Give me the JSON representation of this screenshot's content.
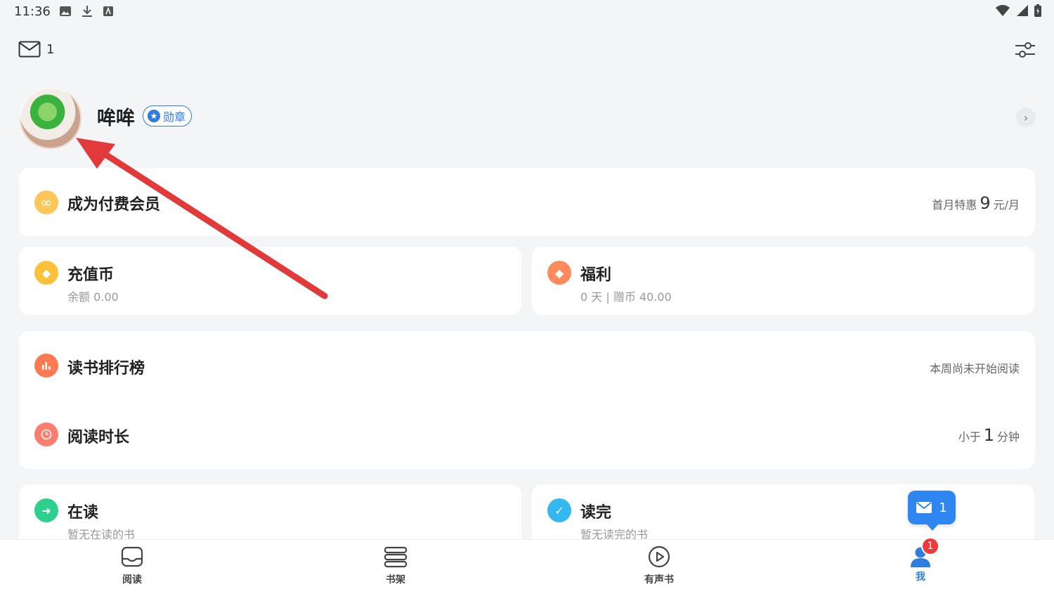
{
  "status_bar": {
    "time": "11:36"
  },
  "top": {
    "mail_count": "1"
  },
  "profile": {
    "name": "哞哞",
    "badge": "勋章"
  },
  "vip": {
    "title": "成为付费会员",
    "promo_prefix": "首月特惠",
    "promo_price": "9",
    "promo_suffix": "元/月"
  },
  "coins": {
    "title": "充值币",
    "balance": "余额 0.00"
  },
  "welfare": {
    "title": "福利",
    "detail": "0 天 | 赠币 40.00"
  },
  "ranking": {
    "title": "读书排行榜",
    "status": "本周尚未开始阅读"
  },
  "duration": {
    "title": "阅读时长",
    "prefix": "小于",
    "value": "1",
    "suffix": "分钟"
  },
  "reading": {
    "title": "在读",
    "sub": "暂无在读的书"
  },
  "finished": {
    "title": "读完",
    "sub": "暂无读完的书"
  },
  "floating_mail": {
    "count": "1"
  },
  "tabs": [
    {
      "label": "阅读",
      "icon": "book-tray-icon"
    },
    {
      "label": "书架",
      "icon": "bookshelf-icon"
    },
    {
      "label": "有声书",
      "icon": "play-circle-icon"
    },
    {
      "label": "我",
      "icon": "person-icon",
      "badge": "1"
    }
  ],
  "colors": {
    "accent": "#2f7de1",
    "background": "#f3f5f7",
    "annotation_arrow": "#e23a3a"
  }
}
